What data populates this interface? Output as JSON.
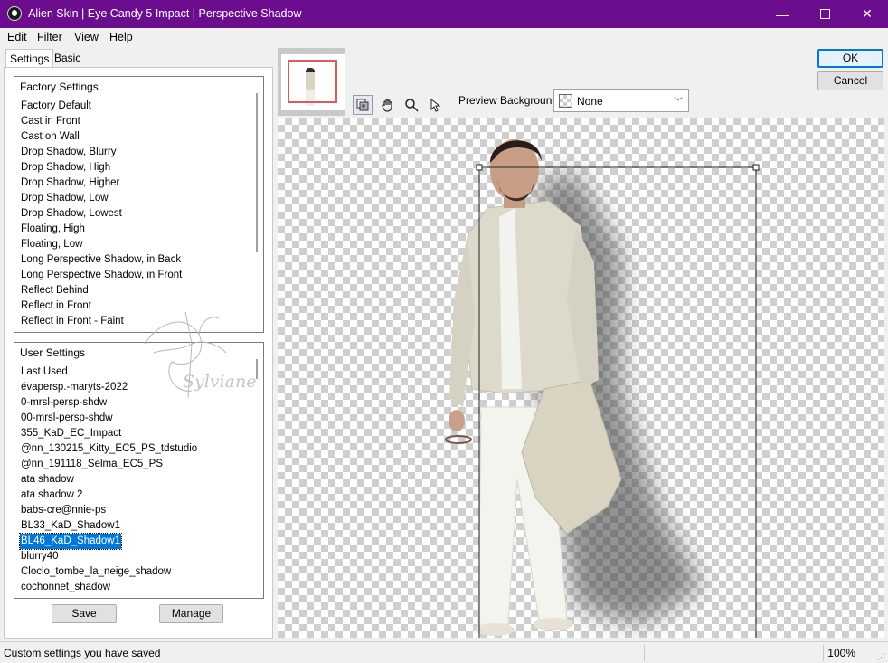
{
  "window": {
    "title": "Alien Skin | Eye Candy 5 Impact | Perspective Shadow",
    "minimize_glyph": "—",
    "maximize_glyph": "☐",
    "close_glyph": "✕"
  },
  "menu": {
    "edit": "Edit",
    "filter": "Filter",
    "view": "View",
    "help": "Help"
  },
  "tabs": {
    "settings": "Settings",
    "basic": "Basic"
  },
  "factory": {
    "header": "Factory Settings",
    "items": [
      "Factory Default",
      "Cast in Front",
      "Cast on Wall",
      "Drop Shadow, Blurry",
      "Drop Shadow, High",
      "Drop Shadow, Higher",
      "Drop Shadow, Low",
      "Drop Shadow, Lowest",
      "Floating, High",
      "Floating, Low",
      "Long Perspective Shadow, in Back",
      "Long Perspective Shadow, in Front",
      "Reflect Behind",
      "Reflect in Front",
      "Reflect in Front - Faint"
    ]
  },
  "user": {
    "header": "User Settings",
    "items": [
      "Last Used",
      "évapersp.-maryts-2022",
      "0-mrsl-persp-shdw",
      "00-mrsl-persp-shdw",
      "355_KaD_EC_Impact",
      "@nn_130215_Kitty_EC5_PS_tdstudio",
      "@nn_191118_Selma_EC5_PS",
      "ata shadow",
      "ata shadow 2",
      "babs-cre@nnie-ps",
      "BL33_KaD_Shadow1",
      "BL46_KaD_Shadow1",
      "blurry40",
      "Cloclo_tombe_la_neige_shadow",
      "cochonnet_shadow"
    ],
    "selected": "BL46_KaD_Shadow1"
  },
  "buttons": {
    "save": "Save",
    "manage": "Manage",
    "ok": "OK",
    "cancel": "Cancel"
  },
  "toolbar": {
    "preview_background_label": "Preview Background:",
    "preview_background_value": "None",
    "tools": [
      "navigator-icon",
      "hand-icon",
      "zoom-icon",
      "pointer-icon"
    ]
  },
  "watermark": {
    "text": "Sylviane"
  },
  "status": {
    "text": "Custom settings you have saved",
    "zoom": "100%"
  },
  "colors": {
    "titlebar": "#6c0d8f",
    "selection": "#0078d7",
    "thumb_frame": "#e05a5a"
  }
}
